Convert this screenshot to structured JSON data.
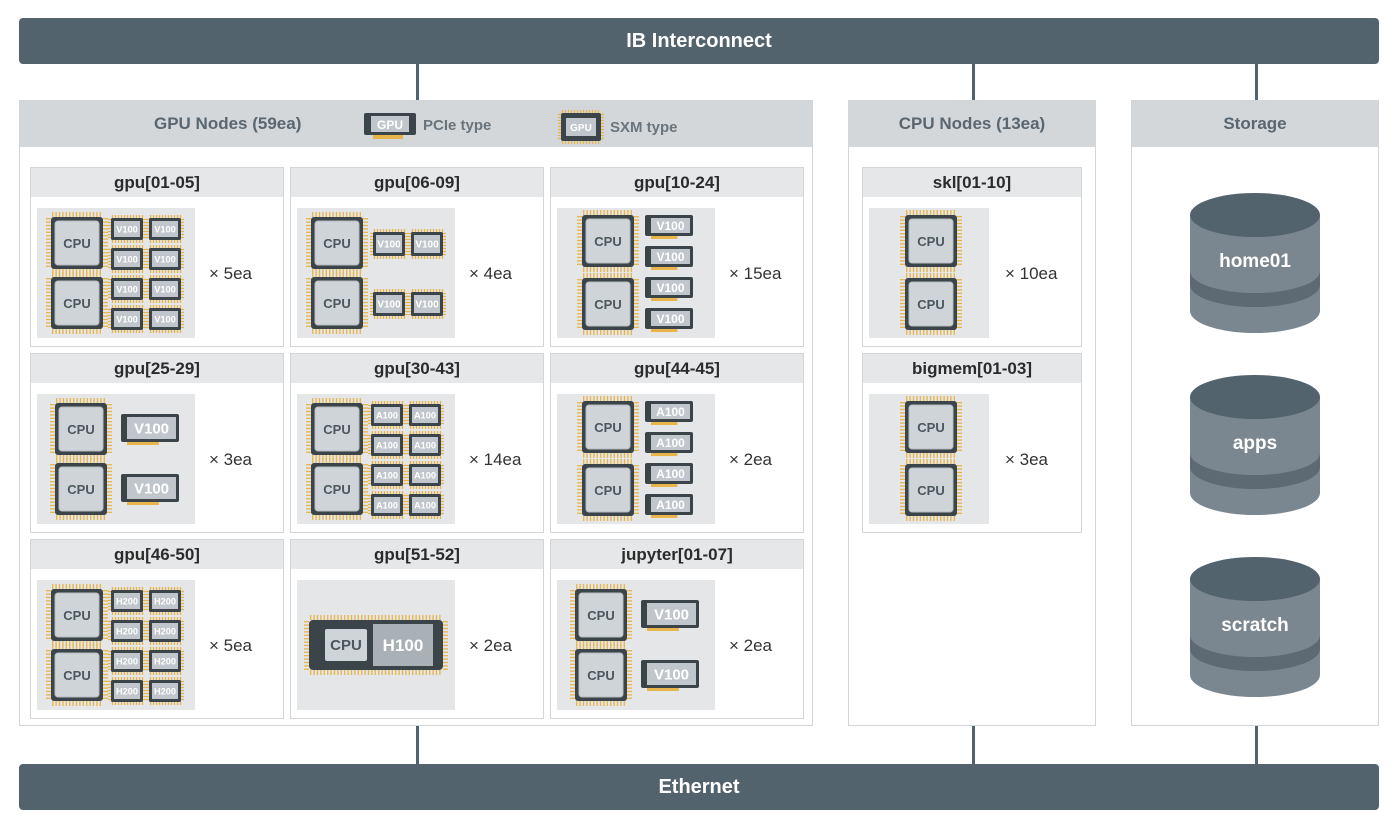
{
  "top_bar": "IB Interconnect",
  "bottom_bar": "Ethernet",
  "gpu_panel": {
    "title": "GPU Nodes (59ea)",
    "legend": [
      {
        "chip": "GPU",
        "label": "PCIe type"
      },
      {
        "chip": "GPU",
        "label": "SXM type"
      }
    ],
    "nodes": [
      {
        "name": "gpu[01-05]",
        "count": "× 5ea",
        "cpu": "CPU",
        "gpu": "V100"
      },
      {
        "name": "gpu[06-09]",
        "count": "× 4ea",
        "cpu": "CPU",
        "gpu": "V100"
      },
      {
        "name": "gpu[10-24]",
        "count": "× 15ea",
        "cpu": "CPU",
        "gpu": "V100"
      },
      {
        "name": "gpu[25-29]",
        "count": "× 3ea",
        "cpu": "CPU",
        "gpu": "V100"
      },
      {
        "name": "gpu[30-43]",
        "count": "× 14ea",
        "cpu": "CPU",
        "gpu": "A100"
      },
      {
        "name": "gpu[44-45]",
        "count": "× 2ea",
        "cpu": "CPU",
        "gpu": "A100"
      },
      {
        "name": "gpu[46-50]",
        "count": "× 5ea",
        "cpu": "CPU",
        "gpu": "H200"
      },
      {
        "name": "gpu[51-52]",
        "count": "× 2ea",
        "cpu": "CPU",
        "gpu": "H100"
      },
      {
        "name": "jupyter[01-07]",
        "count": "× 2ea",
        "cpu": "CPU",
        "gpu": "V100"
      }
    ]
  },
  "cpu_panel": {
    "title": "CPU Nodes (13ea)",
    "nodes": [
      {
        "name": "skl[01-10]",
        "count": "× 10ea",
        "cpu": "CPU"
      },
      {
        "name": "bigmem[01-03]",
        "count": "× 3ea",
        "cpu": "CPU"
      }
    ]
  },
  "storage_panel": {
    "title": "Storage",
    "volumes": [
      "home01",
      "apps",
      "scratch"
    ]
  },
  "colors": {
    "bar": "#53636e",
    "panel_header": "#d3d7da",
    "chip_board": "#3b4449",
    "chip_pins": "#e8b54a",
    "storage": "#7b8790"
  }
}
